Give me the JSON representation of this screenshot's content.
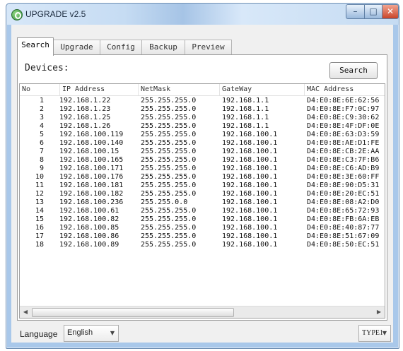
{
  "window": {
    "title": "UPGRADE v2.5",
    "controls": {
      "minimize": "–",
      "maximize": "□",
      "close": "✕"
    }
  },
  "tabs": [
    {
      "label": "Search",
      "active": true
    },
    {
      "label": "Upgrade",
      "active": false
    },
    {
      "label": "Config",
      "active": false
    },
    {
      "label": "Backup",
      "active": false
    },
    {
      "label": "Preview",
      "active": false
    }
  ],
  "search_panel": {
    "devices_label": "Devices:",
    "search_button": "Search",
    "columns": [
      "No",
      "IP Address",
      "NetMask",
      "GateWay",
      "MAC Address"
    ],
    "rows": [
      [
        "1",
        "192.168.1.22",
        "255.255.255.0",
        "192.168.1.1",
        "D4:E0:8E:6E:62:56"
      ],
      [
        "2",
        "192.168.1.23",
        "255.255.255.0",
        "192.168.1.1",
        "D4:E0:8E:F7:0C:97"
      ],
      [
        "3",
        "192.168.1.25",
        "255.255.255.0",
        "192.168.1.1",
        "D4:E0:8E:C9:30:62"
      ],
      [
        "4",
        "192.168.1.26",
        "255.255.255.0",
        "192.168.1.1",
        "D4:E0:8E:4F:DF:0E"
      ],
      [
        "5",
        "192.168.100.119",
        "255.255.255.0",
        "192.168.100.1",
        "D4:E0:8E:63:D3:59"
      ],
      [
        "6",
        "192.168.100.140",
        "255.255.255.0",
        "192.168.100.1",
        "D4:E0:8E:AE:D1:FE"
      ],
      [
        "7",
        "192.168.100.15",
        "255.255.255.0",
        "192.168.100.1",
        "D4:E0:8E:CB:2E:AA"
      ],
      [
        "8",
        "192.168.100.165",
        "255.255.255.0",
        "192.168.100.1",
        "D4:E0:8E:C3:7F:B6"
      ],
      [
        "9",
        "192.168.100.171",
        "255.255.255.0",
        "192.168.100.1",
        "D4:E0:8E:C6:AD:B9"
      ],
      [
        "10",
        "192.168.100.176",
        "255.255.255.0",
        "192.168.100.1",
        "D4:E0:8E:3E:60:FF"
      ],
      [
        "11",
        "192.168.100.181",
        "255.255.255.0",
        "192.168.100.1",
        "D4:E0:8E:90:D5:31"
      ],
      [
        "12",
        "192.168.100.182",
        "255.255.255.0",
        "192.168.100.1",
        "D4:E0:8E:20:EC:51"
      ],
      [
        "13",
        "192.168.100.236",
        "255.255.0.0",
        "192.168.100.1",
        "D4:E0:8E:08:A2:D0"
      ],
      [
        "14",
        "192.168.100.61",
        "255.255.255.0",
        "192.168.100.1",
        "D4:E0:8E:65:72:93"
      ],
      [
        "15",
        "192.168.100.82",
        "255.255.255.0",
        "192.168.100.1",
        "D4:E0:8E:FB:6A:EB"
      ],
      [
        "16",
        "192.168.100.85",
        "255.255.255.0",
        "192.168.100.1",
        "D4:E0:8E:40:87:77"
      ],
      [
        "17",
        "192.168.100.86",
        "255.255.255.0",
        "192.168.100.1",
        "D4:E0:8E:51:67:09"
      ],
      [
        "18",
        "192.168.100.89",
        "255.255.255.0",
        "192.168.100.1",
        "D4:E0:8E:50:EC:51"
      ]
    ],
    "scrollbar": {
      "left_arrow": "◀",
      "right_arrow": "▶"
    }
  },
  "footer": {
    "language_label": "Language",
    "language_value": "English",
    "type_value": "TYPE1",
    "dropdown_arrow": "▼"
  }
}
